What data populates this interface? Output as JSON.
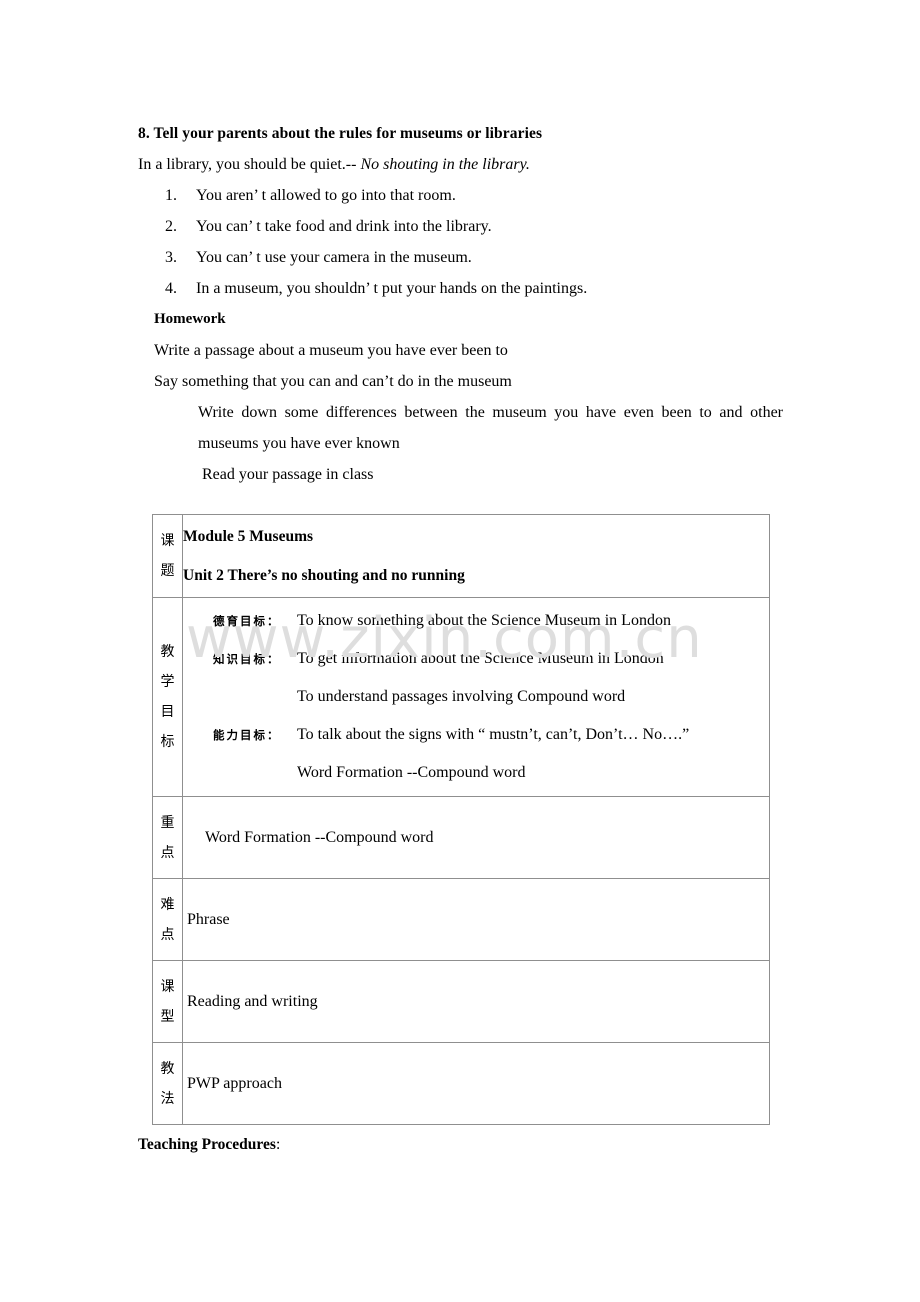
{
  "document": {
    "section_heading": "8. Tell your parents about the rules for museums or libraries",
    "intro_plain": "In a library, you should be quiet.-- ",
    "intro_italic": "No shouting in the library.",
    "rules": [
      {
        "num": "1.",
        "text": "You aren’ t allowed to go into that room."
      },
      {
        "num": "2.",
        "text": "You can’ t take food and drink into the library."
      },
      {
        "num": "3.",
        "text": "You can’ t use your camera in the museum."
      },
      {
        "num": "4.",
        "text": "In a museum, you shouldn’ t put your hands on the paintings."
      }
    ],
    "homework": {
      "title": "Homework",
      "line1": "Write a passage about a museum you have ever been to",
      "line2": "Say something that you can and can’t do in the museum",
      "line3": "Write down some differences between the museum you have even been to and other",
      "line4": "museums you have ever known",
      "line5": "Read your passage in class"
    },
    "watermark": "www.zixin.com.cn",
    "footer": {
      "bold": "Teaching Procedures",
      "tail": ":"
    }
  },
  "table": {
    "rows": [
      {
        "label": "课题",
        "label_chars": [
          "课",
          "题"
        ],
        "line1": "Module 5    Museums",
        "line2": "Unit 2 There’s no shouting and no running"
      },
      {
        "label": "教学目标",
        "label_chars": [
          "教",
          "学",
          "目",
          "标"
        ],
        "objectives": [
          {
            "tag": "德育目标：",
            "text": "To know something about the Science Museum in London"
          },
          {
            "tag": "知识目标：",
            "text": "To get information about the    Science Museum in London"
          },
          {
            "tag": "",
            "text": "To understand passages involving    Compound word"
          },
          {
            "tag": "能力目标：",
            "text": "To talk about the signs with “ mustn’t, can’t, Don’t… No….”"
          },
          {
            "tag": "",
            "text": "Word Formation --Compound word"
          }
        ]
      },
      {
        "label": "重点",
        "label_chars": [
          "重",
          "点"
        ],
        "value": "Word Formation --Compound word"
      },
      {
        "label": "难点",
        "label_chars": [
          "难",
          "点"
        ],
        "value": "Phrase"
      },
      {
        "label": "课型",
        "label_chars": [
          "课",
          "型"
        ],
        "value": "Reading and writing"
      },
      {
        "label": "教法",
        "label_chars": [
          "教",
          "法"
        ],
        "value": "PWP approach"
      }
    ]
  },
  "colors": {
    "text": "#000000",
    "border": "#8f8f8f",
    "watermark": "#dedede",
    "page_background": "#ffffff"
  }
}
